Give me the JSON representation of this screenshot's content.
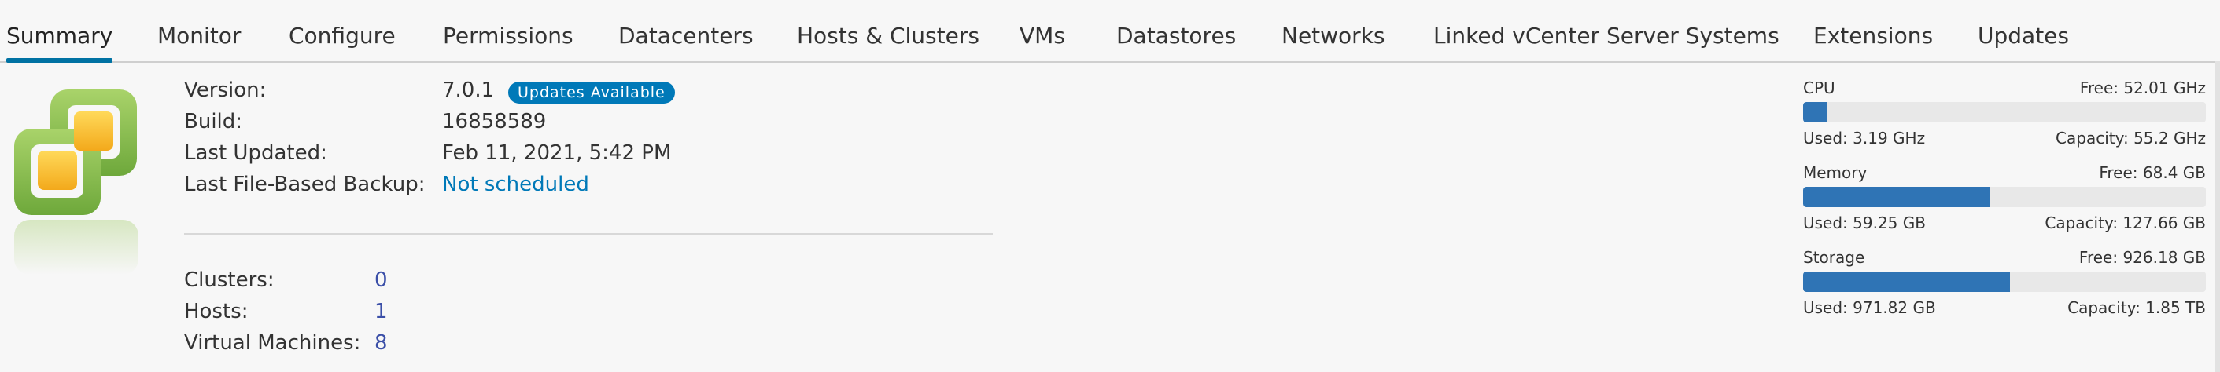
{
  "tabs": [
    {
      "label": "Summary",
      "active": true
    },
    {
      "label": "Monitor"
    },
    {
      "label": "Configure"
    },
    {
      "label": "Permissions"
    },
    {
      "label": "Datacenters"
    },
    {
      "label": "Hosts & Clusters"
    },
    {
      "label": "VMs"
    },
    {
      "label": "Datastores"
    },
    {
      "label": "Networks"
    },
    {
      "label": "Linked vCenter Server Systems"
    },
    {
      "label": "Extensions"
    },
    {
      "label": "Updates"
    }
  ],
  "info": {
    "version_label": "Version:",
    "version_value": "7.0.1",
    "updates_badge": "Updates Available",
    "build_label": "Build:",
    "build_value": "16858589",
    "updated_label": "Last Updated:",
    "updated_value": "Feb 11, 2021, 5:42 PM",
    "backup_label": "Last File-Based Backup:",
    "backup_value": "Not scheduled"
  },
  "counts": {
    "clusters_label": "Clusters:",
    "clusters_value": "0",
    "hosts_label": "Hosts:",
    "hosts_value": "1",
    "vms_label": "Virtual Machines:",
    "vms_value": "8"
  },
  "resources": {
    "cpu": {
      "title": "CPU",
      "free": "Free: 52.01 GHz",
      "used": "Used: 3.19 GHz",
      "capacity": "Capacity: 55.2 GHz",
      "fraction": 0.058
    },
    "memory": {
      "title": "Memory",
      "free": "Free: 68.4 GB",
      "used": "Used: 59.25 GB",
      "capacity": "Capacity: 127.66 GB",
      "fraction": 0.464
    },
    "storage": {
      "title": "Storage",
      "free": "Free: 926.18 GB",
      "used": "Used: 971.82 GB",
      "capacity": "Capacity: 1.85 TB",
      "fraction": 0.513
    }
  },
  "colors": {
    "accent": "#0072a3",
    "bar_fill": "#2f74b5",
    "badge": "#0079b8",
    "link": "#0079b8"
  }
}
